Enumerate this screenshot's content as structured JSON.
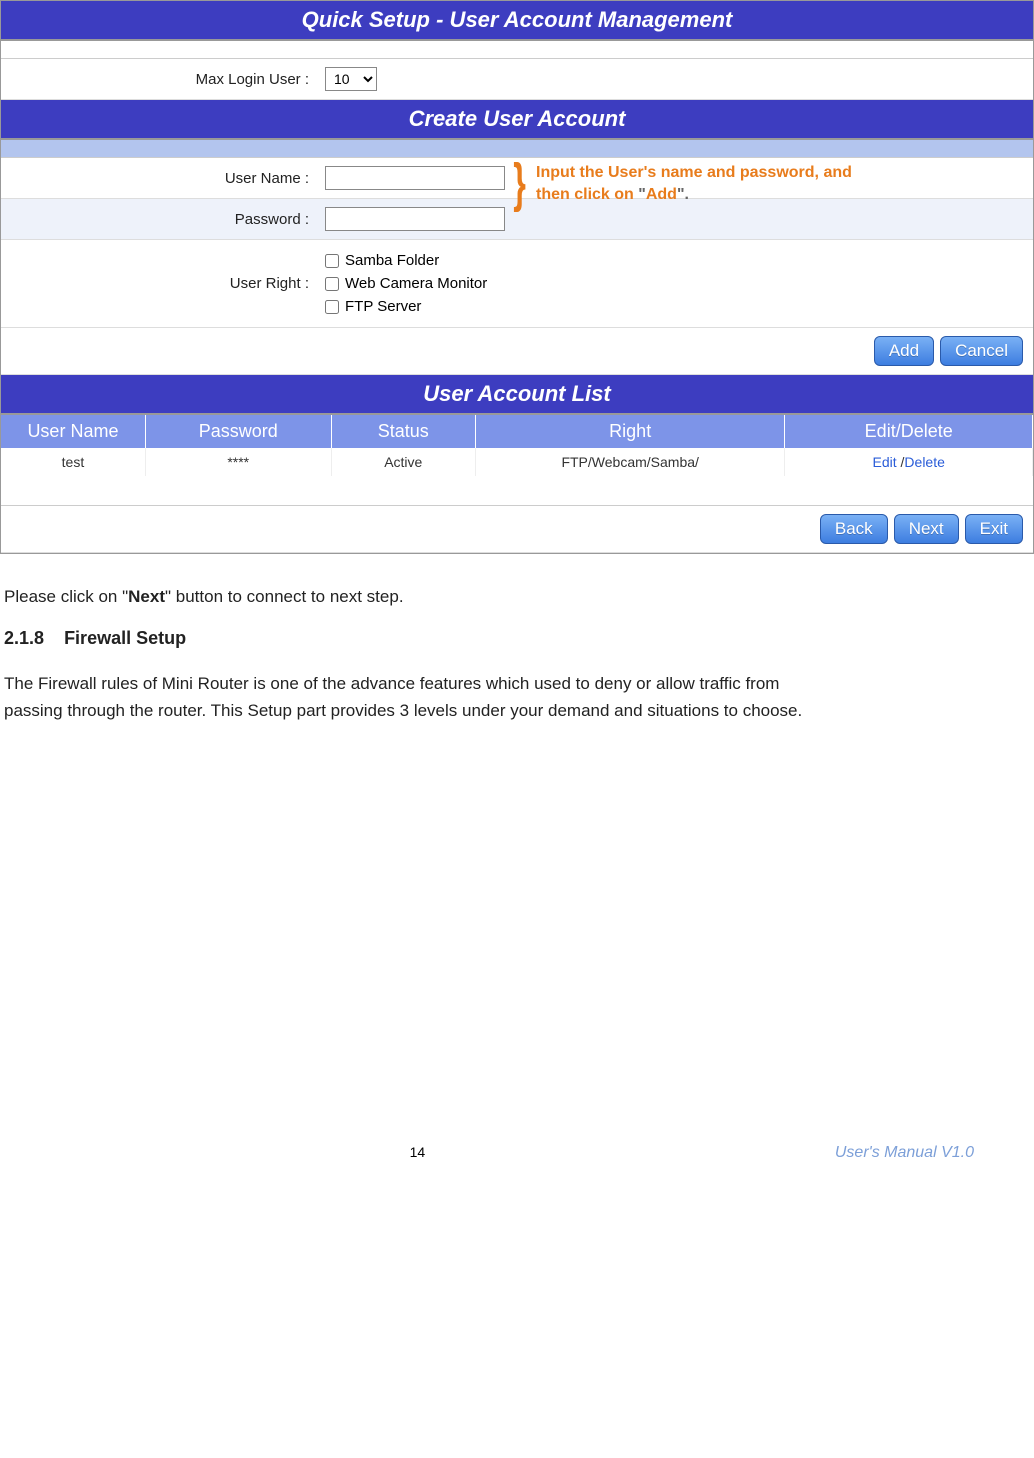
{
  "screenshot": {
    "title_bar": "Quick Setup - User Account Management",
    "max_login_user_label": "Max Login User :",
    "max_login_user_value": "10",
    "section_create": "Create User Account",
    "username_label": "User Name :",
    "password_label": "Password :",
    "user_right_label": "User Right :",
    "rights": {
      "samba": "Samba Folder",
      "webcam": "Web Camera Monitor",
      "ftp": "FTP Server"
    },
    "callout": {
      "line1_a": "Input the User's name and password, and",
      "line2_a": "then click on",
      "line2_q1": " \"",
      "line2_add": "Add",
      "line2_q2": "\".",
      "full_concat": "Input the User's name and password, and then click on \"Add\"."
    },
    "buttons": {
      "add": "Add",
      "cancel": "Cancel",
      "back": "Back",
      "next": "Next",
      "exit": "Exit"
    },
    "section_list": "User Account List",
    "table_headers": {
      "username": "User Name",
      "password": "Password",
      "status": "Status",
      "right": "Right",
      "editdel": "Edit/Delete"
    },
    "table_rows": [
      {
        "username": "test",
        "password": "****",
        "status": "Active",
        "right": "FTP/Webcam/Samba/",
        "edit": "Edit",
        "sep": " /",
        "delete": "Delete"
      }
    ]
  },
  "doc": {
    "p1_a": "Please click on \"",
    "p1_b": "Next",
    "p1_c": "\" button to connect to next step.",
    "h3_num": "2.1.8",
    "h3_title": "Firewall Setup",
    "p2": "The Firewall rules of Mini Router is one of the advance features which used to deny or allow traffic from passing through the router. This Setup part provides 3 levels under your demand and situations to choose."
  },
  "footer": {
    "page": "14",
    "version": "User's Manual V1.0"
  }
}
